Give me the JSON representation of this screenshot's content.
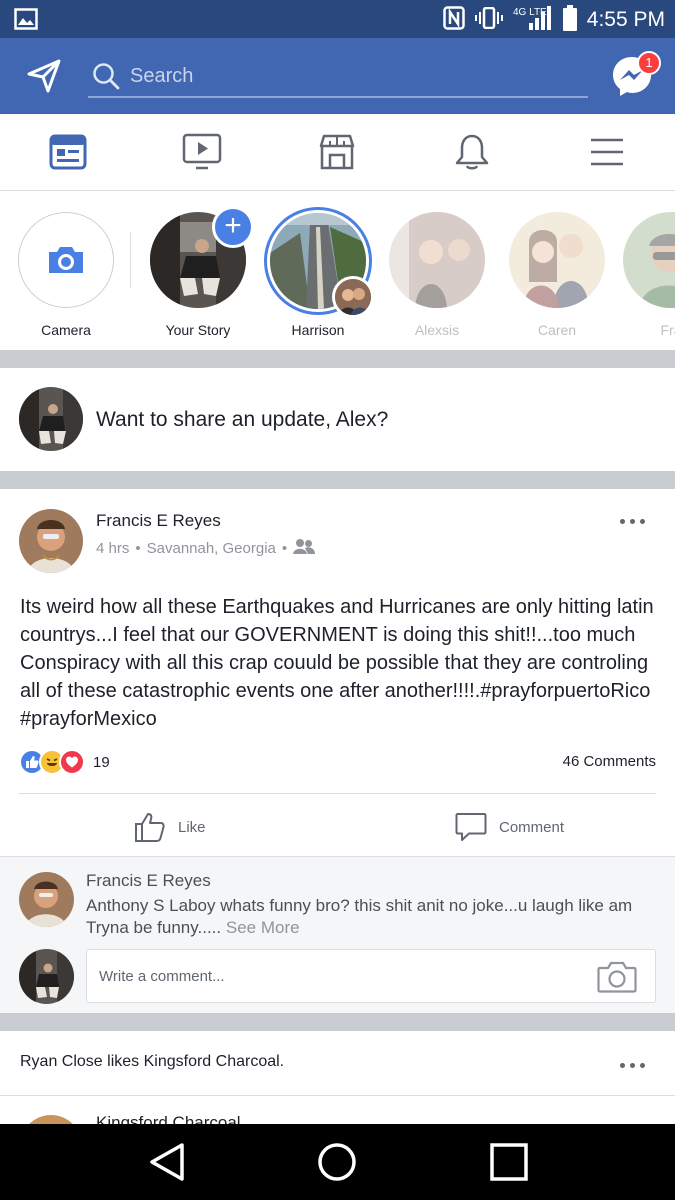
{
  "status_bar": {
    "time": "4:55 PM",
    "network": "4G LTE",
    "icons": [
      "gallery-notification-icon",
      "nfc-icon",
      "vibrate-icon",
      "signal-icon",
      "battery-icon"
    ]
  },
  "top_bar": {
    "search_placeholder": "Search",
    "messenger_badge": "1",
    "icons": [
      "send-icon",
      "search-icon",
      "messenger-icon"
    ],
    "background_color": "#4267b2"
  },
  "tabs": [
    {
      "id": "news-feed",
      "icon": "news-feed-icon",
      "active": true
    },
    {
      "id": "watch",
      "icon": "video-icon",
      "active": false
    },
    {
      "id": "marketplace",
      "icon": "marketplace-icon",
      "active": false
    },
    {
      "id": "notifications",
      "icon": "bell-icon",
      "active": false
    },
    {
      "id": "menu",
      "icon": "menu-icon",
      "active": false
    }
  ],
  "stories": [
    {
      "label": "Camera"
    },
    {
      "label": "Your Story"
    },
    {
      "label": "Harrison"
    },
    {
      "label": "Alexsis"
    },
    {
      "label": "Caren"
    },
    {
      "label": "Fra"
    }
  ],
  "composer": {
    "prompt": "Want to share an update, Alex?"
  },
  "post": {
    "author": "Francis E Reyes",
    "time": "4 hrs",
    "location": "Savannah, Georgia",
    "audience_icon": "friends-icon",
    "text": "Its weird how all these Earthquakes and Hurricanes are only hitting latin countrys...I feel that our GOVERNMENT is doing this shit!!...too much Conspiracy with all this crap couuld be possible that they are controling all of these catastrophic events one after another!!!!.#prayforpuertoRico #prayforMexico",
    "reactions": [
      "like",
      "haha",
      "love"
    ],
    "reaction_count": "19",
    "comments_count": "46 Comments",
    "actions": {
      "like": "Like",
      "comment": "Comment"
    },
    "top_comment": {
      "author": "Francis E Reyes",
      "text": "Anthony S Laboy whats funny bro? this shit anit no joke...u laugh like am Tryna be funny.....",
      "see_more": "See More"
    },
    "write_comment_placeholder": "Write a comment..."
  },
  "next_story": {
    "activity": "Ryan Close likes Kingsford Charcoal.",
    "page_name": "Kingsford Charcoal"
  },
  "nav_bar": {
    "icons": [
      "back-icon",
      "home-icon",
      "recents-icon"
    ]
  },
  "colors": {
    "facebook_blue": "#4267b2",
    "status_bar": "#29487d",
    "accent_blue": "#4a7fe4",
    "badge_red": "#fa3e3e"
  }
}
